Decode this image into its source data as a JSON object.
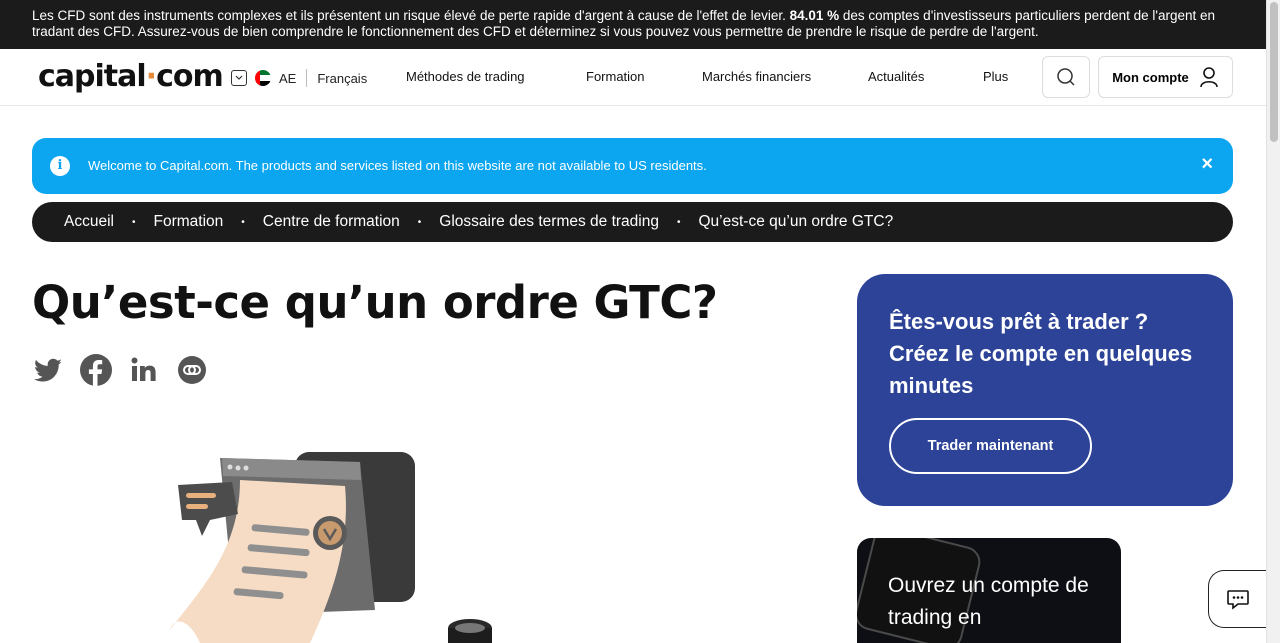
{
  "risk_warning": {
    "text_before": "Les CFD sont des instruments complexes et ils présentent un risque élevé de perte rapide d'argent à cause de l'effet de levier. ",
    "percent": "84.01 %",
    "text_after": " des comptes d'investisseurs particuliers perdent de l'argent en tradant des CFD. Assurez-vous de bien comprendre le fonctionnement des CFD et déterminez si vous pouvez vous permettre de prendre le risque de perdre de l'argent."
  },
  "header": {
    "logo_left": "capital",
    "logo_dot": "·",
    "logo_right": "com",
    "region": "AE",
    "language": "Français",
    "nav": [
      "Méthodes de trading",
      "Formation",
      "Marchés financiers",
      "Actualités",
      "Plus"
    ],
    "account_label": "Mon compte"
  },
  "banner": {
    "info_icon": "i",
    "message": "Welcome to Capital.com. The products and services listed on this website are not available to US residents.",
    "close": "×"
  },
  "breadcrumbs": [
    "Accueil",
    "Formation",
    "Centre de formation",
    "Glossaire des termes de trading",
    "Qu’est-ce qu’un ordre GTC?"
  ],
  "breadcrumb_separator": "•",
  "article": {
    "title": "Qu’est-ce qu’un ordre GTC?"
  },
  "share_icons": [
    "twitter-icon",
    "facebook-icon",
    "linkedin-icon",
    "copy-link-icon"
  ],
  "promo": {
    "text": "Êtes-vous prêt à trader ? Créez le compte en quelques minutes",
    "cta_label": "Trader maintenant"
  },
  "card2": {
    "text": "Ouvrez un compte de trading en"
  },
  "colors": {
    "risk_bar": "#1b1b1b",
    "banner": "#0ba5f0",
    "promo": "#2c4398",
    "logo_dot": "#e38b3a"
  }
}
